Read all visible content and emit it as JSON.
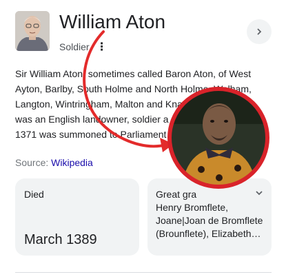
{
  "header": {
    "title": "William Aton",
    "subtitle": "Soldier",
    "more_icon": "more-vertical-icon",
    "expand_icon": "chevron-right-icon"
  },
  "description": {
    "lines": [
      "Sir William Aton, sometimes called Baron Aton, of West",
      "Ayton, Barlby, South Holme and North Holme, Walham,",
      "Langton, Wintringham, Malton and Knapton,",
      "was an English landowner, soldier a",
      "1371 was summoned to Parliament"
    ]
  },
  "source": {
    "label": "Source:",
    "link": "Wikipedia"
  },
  "cards": [
    {
      "label": "Died",
      "value": "March 1389"
    },
    {
      "label": "Great gra",
      "lines": [
        "Henry Bromflete,",
        "Joane|Joan de Bromflete",
        "(Brounflete), Elizabeth…"
      ]
    }
  ],
  "overlay": {
    "arrow_color": "#e32b2b",
    "ring_color": "#d9232a"
  }
}
